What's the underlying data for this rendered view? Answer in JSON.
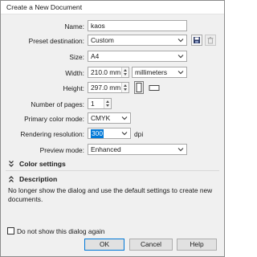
{
  "window": {
    "title": "Create a New Document"
  },
  "form": {
    "name": {
      "label": "Name:",
      "value": "kaos"
    },
    "preset": {
      "label": "Preset destination:",
      "value": "Custom"
    },
    "size": {
      "label": "Size:",
      "value": "A4"
    },
    "width": {
      "label": "Width:",
      "value": "210.0 mm",
      "units": "millimeters"
    },
    "height": {
      "label": "Height:",
      "value": "297.0 mm"
    },
    "pages": {
      "label": "Number of pages:",
      "value": "1"
    },
    "color_mode": {
      "label": "Primary color mode:",
      "value": "CMYK"
    },
    "resolution": {
      "label": "Rendering resolution:",
      "value": "300",
      "unit": "dpi"
    },
    "preview": {
      "label": "Preview mode:",
      "value": "Enhanced"
    }
  },
  "sections": {
    "color_settings": "Color settings",
    "description": "Description"
  },
  "description_text": "No longer show the dialog and use the default settings to create new documents.",
  "footer": {
    "checkbox_label": "Do not show this dialog again",
    "ok": "OK",
    "cancel": "Cancel",
    "help": "Help"
  },
  "colors": {
    "accent": "#0078d7",
    "save_icon": "#2b3a67"
  }
}
